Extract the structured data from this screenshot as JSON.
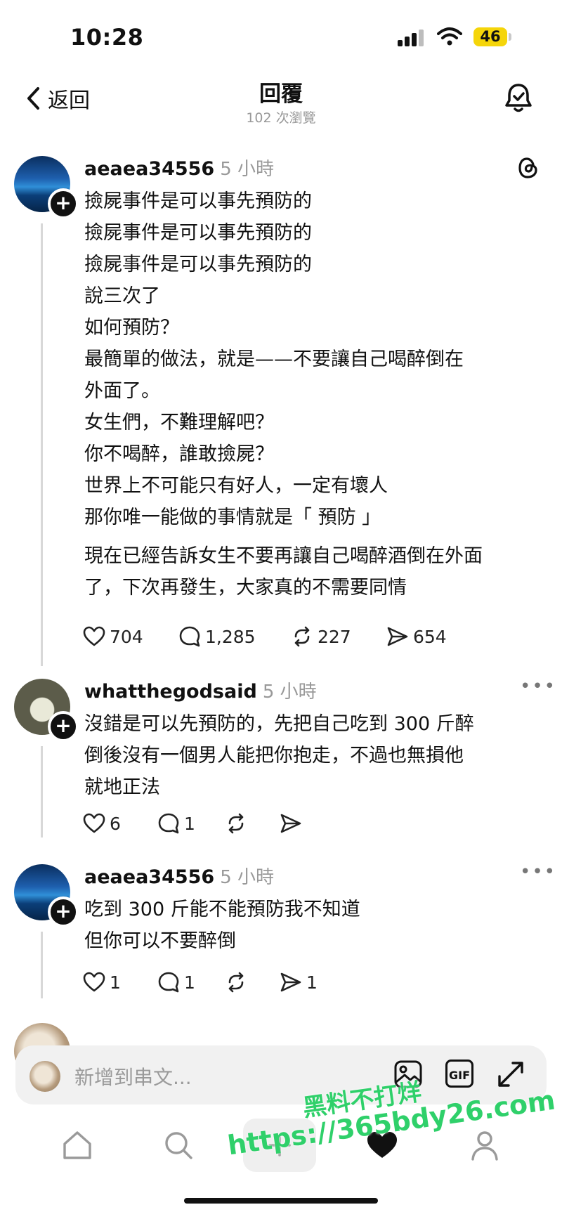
{
  "status_bar": {
    "time": "10:28",
    "battery": "46"
  },
  "header": {
    "back_label": "返回",
    "title": "回覆",
    "subtitle": "102 次瀏覽"
  },
  "posts": [
    {
      "username": "aeaea34556",
      "time": "5 小時",
      "lines": "撿屍事件是可以事先預防的\n撿屍事件是可以事先預防的\n撿屍事件是可以事先預防的\n說三次了\n如何預防？\n最簡單的做法，就是——不要讓自己喝醉倒在\n外面了。\n女生們，不難理解吧？\n你不喝醉，誰敢撿屍？\n世界上不可能只有好人，一定有壞人\n那你唯一能做的事情就是「 預防 」",
      "paragraph2": "現在已經告訴女生不要再讓自己喝醉酒倒在外面\n了，下次再發生，大家真的不需要同情",
      "likes": "704",
      "comments": "1,285",
      "reposts": "227",
      "shares": "654"
    },
    {
      "username": "whatthegodsaid",
      "time": "5 小時",
      "lines": "沒錯是可以先預防的，先把自己吃到 300 斤醉\n倒後沒有一個男人能把你抱走，不過也無損他\n就地正法",
      "likes": "6",
      "comments": "1",
      "reposts": "",
      "shares": ""
    },
    {
      "username": "aeaea34556",
      "time": "5 小時",
      "lines": "吃到 300 斤能不能預防我不知道\n但你可以不要醉倒",
      "likes": "1",
      "comments": "1",
      "reposts": "",
      "shares": "1"
    }
  ],
  "reply_bar": {
    "placeholder": "新增到串文...",
    "gif_label": "GIF"
  },
  "watermark": {
    "line1": "黑料不打烊",
    "line2": "https://365bdy26.com"
  },
  "icons": {
    "back": "chevron-left-icon",
    "notifications": "bell-icon",
    "threads_logo": "threads-logo-icon",
    "more": "more-dots-icon",
    "like": "heart-icon",
    "comment": "comment-icon",
    "repost": "repost-icon",
    "share": "send-icon",
    "image": "image-icon",
    "expand": "expand-icon",
    "home": "home-icon",
    "search": "search-icon",
    "create": "plus-icon",
    "activity": "heart-filled-icon",
    "profile": "person-icon"
  }
}
